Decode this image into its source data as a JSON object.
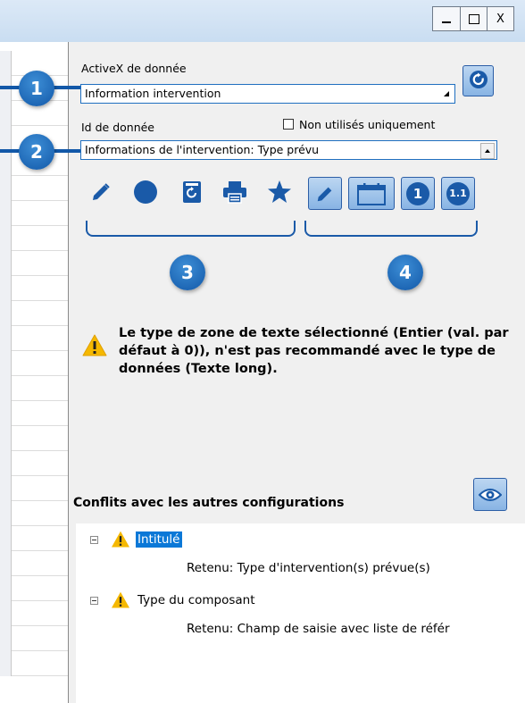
{
  "window": {
    "minimize_symbol": "_",
    "maximize_symbol": "□",
    "close_symbol": "X"
  },
  "activex": {
    "label": "ActiveX de donnée",
    "value": "Information intervention",
    "refresh_icon": "refresh-icon"
  },
  "data_id": {
    "label": "Id de donnée",
    "checkbox_label": "Non utilisés uniquement",
    "checkbox_checked": false,
    "value": "Informations de l'intervention: Type prévu"
  },
  "toolbar_left": [
    "pencil-icon",
    "circle-icon",
    "reset-form-icon",
    "print-icon",
    "star-icon"
  ],
  "toolbar_right": {
    "items": [
      "pencil-icon",
      "calendar-icon",
      "number-one-icon",
      "decimal-icon"
    ],
    "labels": [
      "",
      "",
      "1",
      "1.1"
    ]
  },
  "callouts": [
    "1",
    "2",
    "3",
    "4"
  ],
  "warning": {
    "text": "Le type de zone de texte sélectionné (Entier (val. par défaut à 0)), n'est pas recommandé avec le type de données (Texte long)."
  },
  "conflicts": {
    "title": "Conflits avec les autres configurations",
    "view_icon": "eye-icon",
    "items": [
      {
        "label": "Intitulé",
        "detail": "Retenu: Type d'intervention(s) prévue(s)",
        "selected": true
      },
      {
        "label": "Type du composant",
        "detail": "Retenu: Champ de saisie avec liste de référ",
        "selected": false
      }
    ]
  },
  "colors": {
    "accent_blue": "#1258a8",
    "selection_blue": "#0b78d7",
    "warning_yellow": "#f5b800"
  }
}
